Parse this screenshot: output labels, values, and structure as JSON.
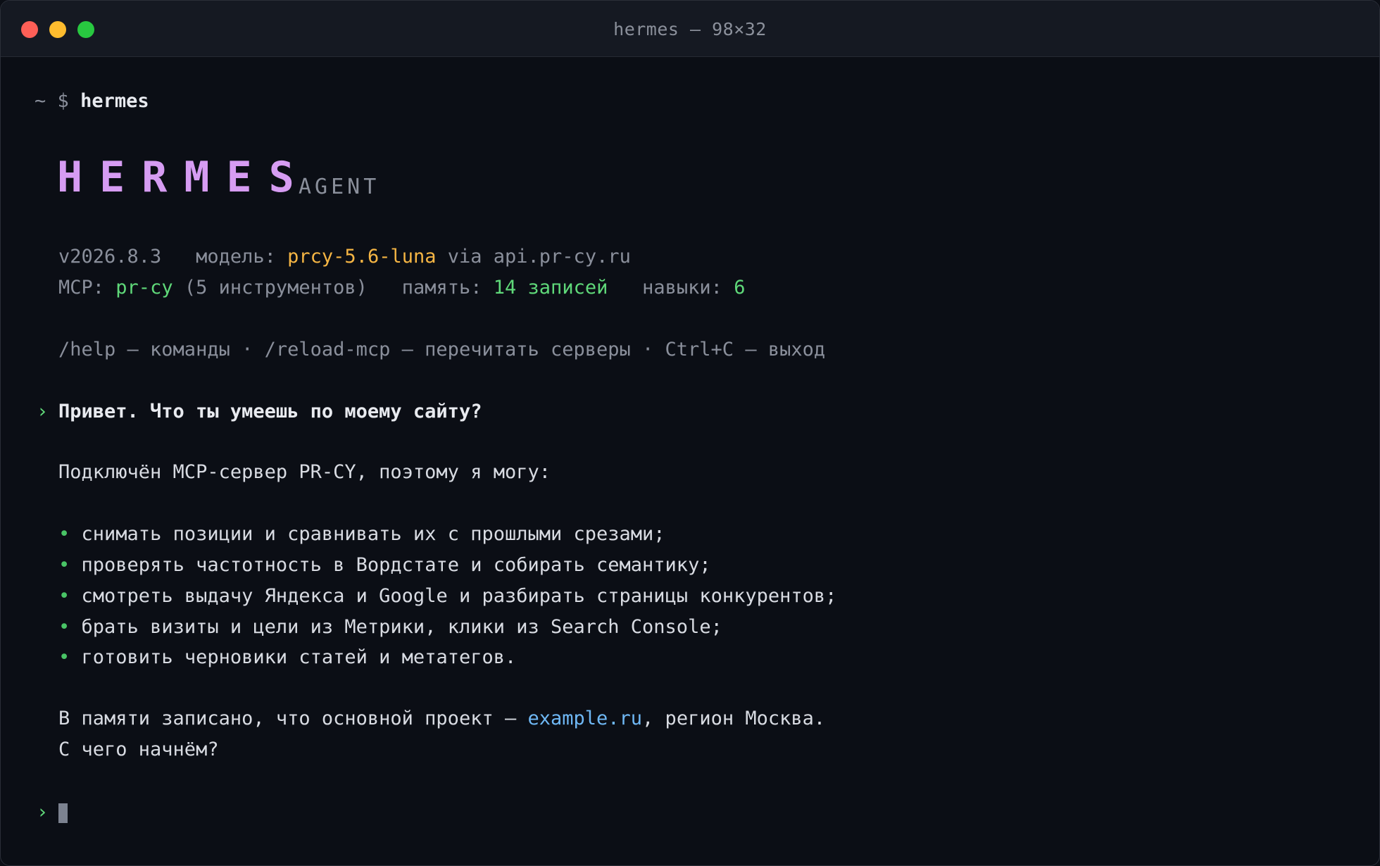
{
  "window": {
    "title": "hermes — 98×32"
  },
  "prompt": {
    "tilde": "~",
    "dollar": "$",
    "command": "hermes"
  },
  "banner": {
    "logo": "HERMES",
    "subtitle": "AGENT",
    "version": "v2026.8.3",
    "model_label": "модель:",
    "model_value": "prcy-5.6-luna",
    "model_via": "via api.pr-cy.ru",
    "mcp_label": "MCP:",
    "mcp_value": "pr-cy",
    "mcp_tools": "(5 инструментов)",
    "memory_label": "память:",
    "memory_value": "14 записей",
    "skills_label": "навыки:",
    "skills_value": "6",
    "help_line": "/help — команды · /reload-mcp — перечитать серверы · Ctrl+C — выход"
  },
  "conversation": {
    "user_marker": "›",
    "user_message": "Привет. Что ты умеешь по моему сайту?",
    "reply_intro": "Подключён MCP-сервер PR-CY, поэтому я могу:",
    "bullet_glyph": "•",
    "bullets": [
      "снимать позиции и сравнивать их с прошлыми срезами;",
      "проверять частотность в Вордстате и собирать семантику;",
      "смотреть выдачу Яндекса и Google и разбирать страницы конкурентов;",
      "брать визиты и цели из Метрики, клики из Search Console;",
      "готовить черновики статей и метатегов."
    ],
    "memory_prefix": "В памяти записано, что основной проект — ",
    "memory_link": "example.ru",
    "memory_suffix": ", регион Москва.",
    "question": "С чего начнём?"
  },
  "input": {
    "marker": "›"
  },
  "colors": {
    "background": "#0b0e15",
    "logo": "#d69cf2",
    "accent_green": "#5fd879",
    "accent_orange": "#f5b544",
    "link_blue": "#6fb8f5"
  }
}
